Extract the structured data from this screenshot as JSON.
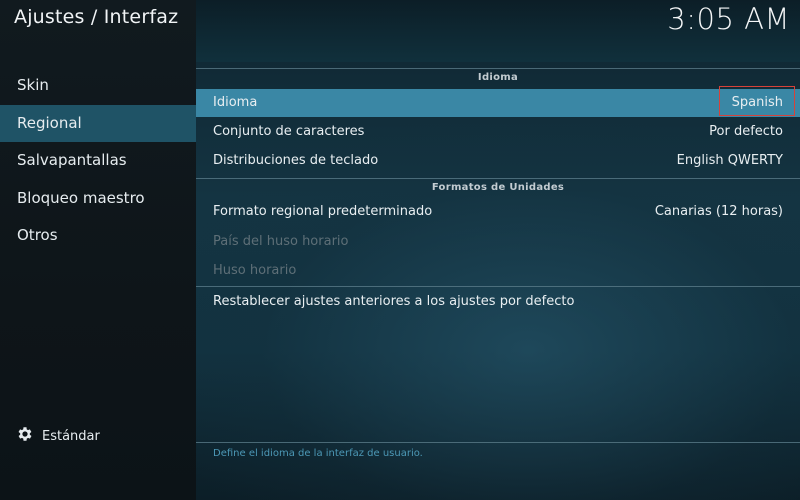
{
  "window": {
    "title": "Ajustes / Interfaz",
    "clock": "3:05 AM"
  },
  "sidebar": {
    "items": [
      {
        "label": "Skin"
      },
      {
        "label": "Regional",
        "active": true
      },
      {
        "label": "Salvapantallas"
      },
      {
        "label": "Bloqueo maestro"
      },
      {
        "label": "Otros"
      }
    ],
    "settings_level": {
      "icon": "gear-icon",
      "label": "Estándar"
    }
  },
  "sections": [
    {
      "title": "Idioma",
      "rows": [
        {
          "label": "Idioma",
          "value": "Spanish",
          "selected": true
        },
        {
          "label": "Conjunto de caracteres",
          "value": "Por defecto"
        },
        {
          "label": "Distribuciones de teclado",
          "value": "English QWERTY"
        }
      ]
    },
    {
      "title": "Formatos de Unidades",
      "rows": [
        {
          "label": "Formato regional predeterminado",
          "value": "Canarias (12 horas)"
        },
        {
          "label": "País del huso horario",
          "value": "",
          "disabled": true
        },
        {
          "label": "Huso horario",
          "value": "",
          "disabled": true
        }
      ]
    }
  ],
  "reset": {
    "label": "Restablecer ajustes anteriores a los ajustes por defecto"
  },
  "help_text": "Define el idioma de la interfaz de usuario.",
  "colors": {
    "selected_row": "#3a87a5",
    "active_sidebar": "#1f5366",
    "highlight_border": "#d6423a",
    "help_text": "#4c98b6"
  }
}
